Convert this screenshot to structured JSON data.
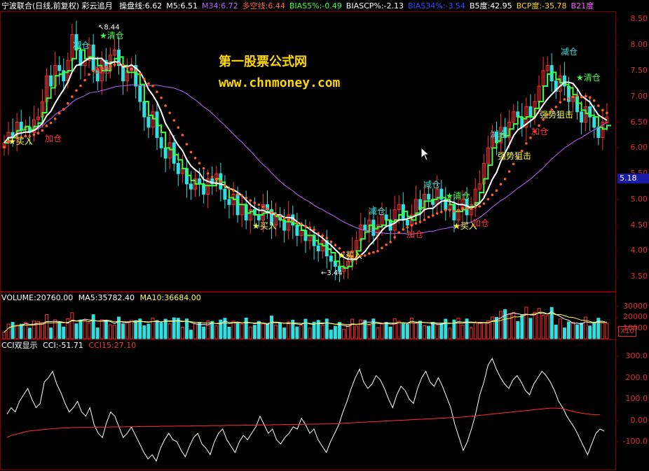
{
  "header": {
    "title": "宁波联合(日线,前复权) 彩云追月",
    "items": [
      {
        "text": "操盘线:6.62",
        "color": "#ffffff"
      },
      {
        "text": "M5:6.51",
        "color": "#ffffff"
      },
      {
        "text": "M34:6.72",
        "color": "#c060ff"
      },
      {
        "text": "多空线:6.44",
        "color": "#ff6040"
      },
      {
        "text": "BIAS5%:-0.49",
        "color": "#40ff40"
      },
      {
        "text": "BIASCP%:-2.13",
        "color": "#ffffff"
      },
      {
        "text": "BIAS34%:-3.54",
        "color": "#4040ff"
      },
      {
        "text": "B5度:42.95",
        "color": "#ffffff"
      },
      {
        "text": "BCP度:-35.78",
        "color": "#ffd700"
      },
      {
        "text": "B21度",
        "color": "#ff60ff"
      }
    ]
  },
  "watermark": {
    "line1": "第一股票公式网",
    "line2": "www.chnmoney.com"
  },
  "price_axis": {
    "labels": [
      "8.50",
      "8.00",
      "7.50",
      "7.00",
      "6.50",
      "6.00",
      "5.50",
      "5.00",
      "4.50",
      "4.00",
      "3.50"
    ],
    "current": "5.18"
  },
  "volume_panel": {
    "label": "VOLUME:20760.00",
    "ma5": "MA5:35782.40",
    "ma10": "MA10:36684.00",
    "axis": [
      "30000",
      "20000",
      "10000"
    ],
    "unit": "X10"
  },
  "cci_panel": {
    "label": "CCI双显示",
    "cci": "CCI:-51.71",
    "cci15": "CCI15:27.10",
    "axis": [
      "300.0",
      "200.0",
      "100.0",
      "0.00",
      "-100.0"
    ]
  },
  "annotations": {
    "high": "8.44",
    "low": "3.44",
    "qingcang": "★清仓",
    "jiancang": "减仓",
    "jiacang": "加仓",
    "buy": "★买入",
    "strong": "强势狙击",
    "buy_add": "★买入加仓"
  },
  "colors": {
    "up": "#ff3030",
    "down": "#30e0e0",
    "bg": "#000000",
    "grid": "#800000",
    "ma_white": "#ffffff",
    "ma_purple": "#c060ff",
    "dots": "#ff6020",
    "step_green": "#40ff40",
    "step_yellow": "#ffff40"
  },
  "chart_data": {
    "type": "candlestick",
    "price_range": [
      3.3,
      8.6
    ],
    "cci_range": [
      -220,
      330
    ],
    "volume_max": 35000,
    "closes": [
      6.1,
      6.3,
      6.2,
      6.5,
      6.35,
      6.4,
      6.3,
      6.55,
      6.6,
      6.9,
      7.4,
      7.2,
      7.6,
      7.5,
      7.3,
      7.7,
      8.2,
      7.9,
      7.6,
      7.7,
      8.0,
      7.5,
      7.3,
      7.7,
      7.5,
      7.8,
      7.9,
      7.6,
      7.3,
      7.5,
      7.6,
      7.2,
      6.9,
      6.6,
      6.4,
      6.7,
      6.2,
      6.0,
      5.8,
      6.1,
      5.7,
      5.5,
      5.6,
      5.3,
      5.2,
      5.4,
      5.3,
      5.1,
      5.4,
      5.3,
      5.5,
      5.2,
      5.0,
      4.9,
      5.1,
      4.7,
      4.9,
      4.6,
      4.8,
      4.7,
      4.6,
      4.9,
      4.8,
      4.5,
      4.7,
      4.6,
      4.4,
      4.7,
      4.5,
      4.3,
      4.4,
      4.2,
      4.3,
      4.1,
      4.0,
      4.2,
      3.9,
      3.8,
      3.7,
      3.6,
      3.7,
      3.8,
      4.0,
      4.2,
      4.5,
      4.4,
      4.6,
      4.3,
      4.5,
      4.7,
      4.6,
      4.4,
      4.8,
      4.9,
      4.6,
      4.5,
      4.7,
      5.0,
      4.8,
      5.1,
      5.0,
      4.9,
      5.2,
      5.0,
      4.8,
      4.9,
      4.6,
      4.8,
      5.0,
      4.7,
      4.9,
      5.2,
      5.3,
      5.7,
      6.0,
      6.3,
      6.1,
      6.4,
      6.2,
      6.5,
      6.7,
      6.6,
      6.4,
      6.8,
      6.6,
      6.9,
      7.2,
      7.5,
      7.6,
      7.3,
      7.1,
      7.4,
      7.2,
      6.9,
      7.0,
      6.7,
      6.5,
      6.8,
      6.6,
      6.4,
      6.2,
      6.5,
      6.6
    ],
    "cci": [
      30,
      60,
      40,
      90,
      120,
      150,
      100,
      60,
      80,
      180,
      200,
      230,
      170,
      130,
      80,
      40,
      60,
      90,
      40,
      20,
      60,
      -20,
      -60,
      -80,
      -10,
      40,
      20,
      -30,
      -80,
      -60,
      -30,
      -70,
      -110,
      -150,
      -180,
      -160,
      -190,
      -130,
      -90,
      -60,
      -90,
      -100,
      -140,
      -170,
      -120,
      -80,
      -60,
      -110,
      -130,
      -160,
      -100,
      -60,
      -40,
      -90,
      -120,
      -150,
      -100,
      -70,
      -90,
      -60,
      -30,
      20,
      -20,
      -60,
      -40,
      -90,
      -110,
      -80,
      -60,
      -30,
      -40,
      10,
      -20,
      -60,
      -40,
      -90,
      -120,
      -150,
      -100,
      -60,
      -20,
      40,
      90,
      150,
      200,
      240,
      180,
      150,
      170,
      210,
      190,
      150,
      100,
      60,
      120,
      160,
      140,
      100,
      80,
      150,
      200,
      230,
      180,
      160,
      200,
      160,
      110,
      60,
      -20,
      -80,
      -140,
      -100,
      -40,
      30,
      120,
      180,
      260,
      290,
      240,
      200,
      170,
      150,
      190,
      210,
      180,
      140,
      120,
      170,
      200,
      230,
      210,
      180,
      140,
      90,
      60,
      20,
      -10,
      -40,
      -80,
      -120,
      -160,
      -110,
      -60,
      -40,
      -50
    ],
    "cci15": [
      -80,
      -70,
      -65,
      -60,
      -55,
      -50,
      -48,
      -46,
      -44,
      -42,
      -40,
      -38,
      -37,
      -36,
      -35,
      -34,
      -33,
      -33,
      -32,
      -32,
      -32,
      -32,
      -31,
      -31,
      -31,
      -30,
      -30,
      -30,
      -30,
      -29,
      -29,
      -29,
      -28,
      -28,
      -28,
      -28,
      -28,
      -27,
      -27,
      -27,
      -27,
      -26,
      -26,
      -26,
      -26,
      -25,
      -25,
      -25,
      -25,
      -24,
      -24,
      -24,
      -24,
      -23,
      -23,
      -23,
      -23,
      -22,
      -22,
      -22,
      -22,
      -21,
      -21,
      -21,
      -20,
      -20,
      -20,
      -19,
      -19,
      -19,
      -18,
      -18,
      -18,
      -17,
      -17,
      -17,
      -16,
      -16,
      -16,
      -15,
      -14,
      -13,
      -12,
      -11,
      -10,
      -9,
      -8,
      -7,
      -6,
      -5,
      -4,
      -3,
      -2,
      -1,
      0,
      1,
      2,
      3,
      4,
      5,
      6,
      7,
      8,
      9,
      10,
      11,
      12,
      13,
      14,
      15,
      16,
      18,
      20,
      22,
      24,
      26,
      28,
      30,
      32,
      34,
      36,
      38,
      40,
      42,
      44,
      46,
      48,
      50,
      52,
      54,
      56,
      58,
      58,
      57,
      55,
      50,
      45,
      40,
      36,
      33,
      30,
      28,
      27,
      27
    ]
  }
}
